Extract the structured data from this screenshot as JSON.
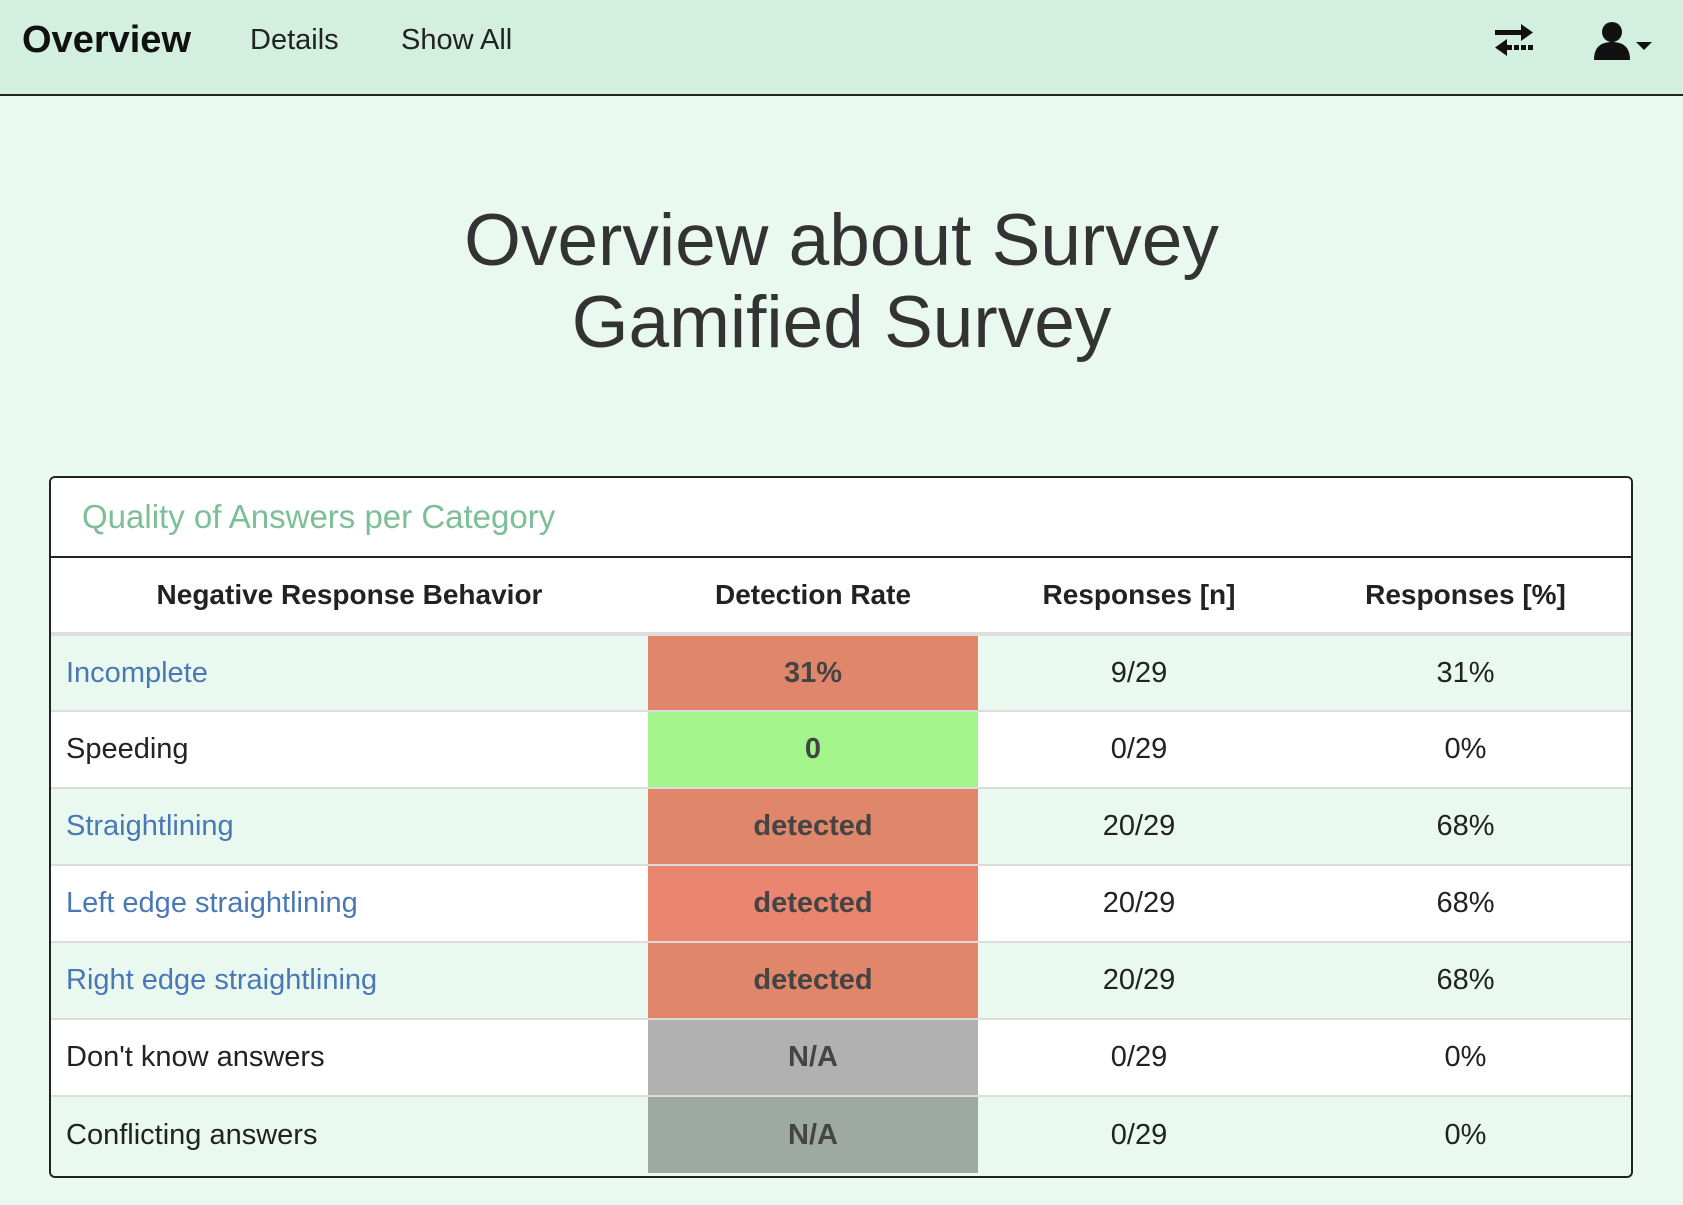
{
  "nav": {
    "brand": "Overview",
    "links": [
      "Details",
      "Show All"
    ],
    "icons": [
      "swap-icon",
      "user-icon",
      "caret-down-icon"
    ]
  },
  "page": {
    "title_line1": "Overview about Survey",
    "title_line2": "Gamified Survey"
  },
  "panel": {
    "heading": "Quality of Answers per Category",
    "heading_color": "#7cbf96",
    "columns": [
      "Negative Response Behavior",
      "Detection Rate",
      "Responses [n]",
      "Responses [%]"
    ],
    "rows": [
      {
        "behavior": "Incomplete",
        "link": true,
        "rate": "31%",
        "rate_color": "#e0866a",
        "n": "9/29",
        "pct": "31%"
      },
      {
        "behavior": "Speeding",
        "link": false,
        "rate": "0",
        "rate_color": "#a4f48c",
        "n": "0/29",
        "pct": "0%"
      },
      {
        "behavior": "Straightlining",
        "link": true,
        "rate": "detected",
        "rate_color": "#e0866a",
        "n": "20/29",
        "pct": "68%"
      },
      {
        "behavior": "Left edge straightlining",
        "link": true,
        "rate": "detected",
        "rate_color": "#ea8670",
        "n": "20/29",
        "pct": "68%"
      },
      {
        "behavior": "Right edge straightlining",
        "link": true,
        "rate": "detected",
        "rate_color": "#e0866a",
        "n": "20/29",
        "pct": "68%"
      },
      {
        "behavior": "Don't know answers",
        "link": false,
        "rate": "N/A",
        "rate_color": "#b1b1b1",
        "n": "0/29",
        "pct": "0%"
      },
      {
        "behavior": "Conflicting answers",
        "link": false,
        "rate": "N/A",
        "rate_color": "#9ea9a2",
        "n": "0/29",
        "pct": "0%"
      }
    ]
  },
  "colors": {
    "navbar_bg": "#d2efe0",
    "page_bg": "#e9f9f0",
    "link": "#4a78b5"
  }
}
